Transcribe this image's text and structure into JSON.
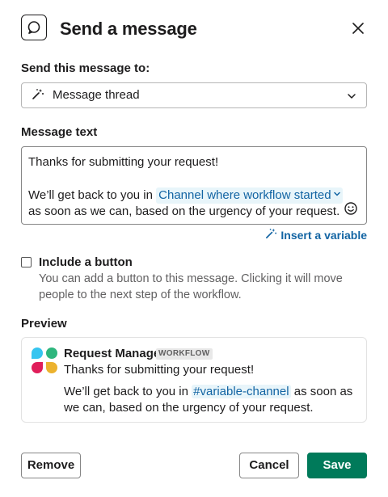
{
  "dialog": {
    "title": "Send a message"
  },
  "recipient": {
    "label": "Send this message to:",
    "selected": "Message thread"
  },
  "message": {
    "label": "Message text",
    "line1": "Thanks for submitting your request!",
    "line2_prefix": "We’ll get back to you in",
    "variable": "Channel where workflow started",
    "line3": "as soon as we can, based on the urgency of your request."
  },
  "insert_variable_label": "Insert a variable",
  "include_button": {
    "label": "Include a button",
    "hint": "You can add a button to this message. Clicking it will move people to the next step of the workflow.",
    "checked": false
  },
  "preview": {
    "label": "Preview",
    "sender": "Request Manager",
    "badge": "WORKFLOW",
    "line1": "Thanks for submitting your request!",
    "line2_prefix": "We’ll get back to you in",
    "channel": "#variable-channel",
    "line2_suffix": "as soon as we can, based on the urgency of your request."
  },
  "footer": {
    "remove_label": "Remove",
    "cancel_label": "Cancel",
    "save_label": "Save"
  },
  "colors": {
    "accent": "#1264a3",
    "save": "#007a5a",
    "chip_bg": "#e8f5fa"
  }
}
